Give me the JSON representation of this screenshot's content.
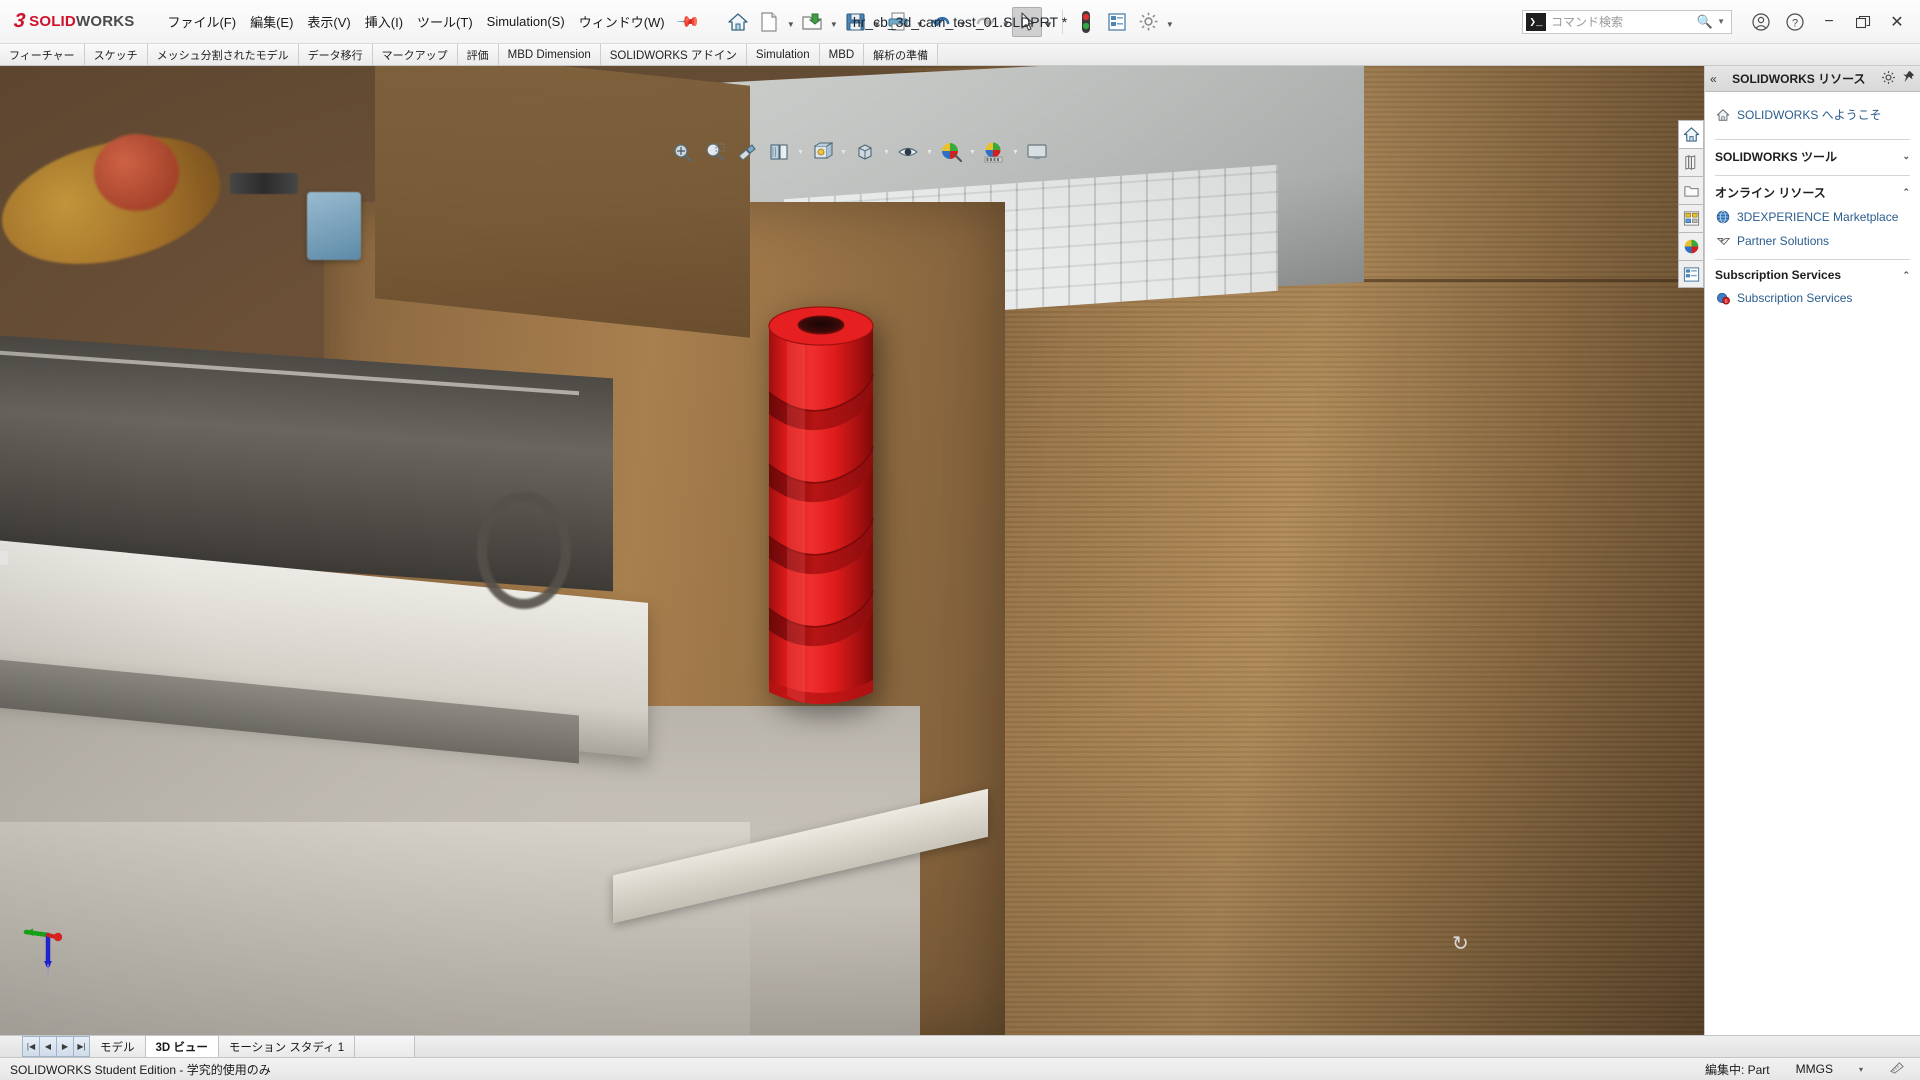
{
  "app": {
    "brand_ds": "3DS",
    "brand_solid": "SOLID",
    "brand_works": "WORKS",
    "accent_red": "#d0112b",
    "model_red": "#dd1a1a"
  },
  "titlebar": {
    "document_title": "hr_cb_3d_cam_test_01.SLDPRT *",
    "menus": [
      {
        "label": "ファイル(F)",
        "name": "menu-file"
      },
      {
        "label": "編集(E)",
        "name": "menu-edit"
      },
      {
        "label": "表示(V)",
        "name": "menu-view"
      },
      {
        "label": "挿入(I)",
        "name": "menu-insert"
      },
      {
        "label": "ツール(T)",
        "name": "menu-tools"
      },
      {
        "label": "Simulation(S)",
        "name": "menu-simulation"
      },
      {
        "label": "ウィンドウ(W)",
        "name": "menu-window"
      }
    ],
    "tools": [
      {
        "name": "home-icon",
        "title": "ホーム"
      },
      {
        "name": "new-document-icon",
        "title": "新規"
      },
      {
        "name": "open-folder-icon",
        "title": "開く"
      },
      {
        "name": "save-icon",
        "title": "保存"
      },
      {
        "name": "print-icon",
        "title": "印刷"
      },
      {
        "name": "undo-icon",
        "title": "元に戻す"
      },
      {
        "name": "redo-icon",
        "title": "やり直し"
      },
      {
        "name": "select-cursor-icon",
        "title": "選択"
      },
      {
        "name": "traffic-light-icon",
        "title": "再構築"
      },
      {
        "name": "options-list-icon",
        "title": "オプション"
      },
      {
        "name": "gear-settings-icon",
        "title": "設定"
      }
    ],
    "search": {
      "placeholder": "コマンド検索",
      "prompt_glyph": "❯_"
    },
    "window": {
      "account": "account-icon",
      "help": "help-icon",
      "minimize": "−",
      "restore": "❐",
      "close": "✕"
    }
  },
  "command_tabs": [
    {
      "label": "フィーチャー",
      "selected": false
    },
    {
      "label": "スケッチ",
      "selected": false
    },
    {
      "label": "メッシュ分割されたモデル",
      "selected": false
    },
    {
      "label": "データ移行",
      "selected": false
    },
    {
      "label": "マークアップ",
      "selected": false
    },
    {
      "label": "評価",
      "selected": false
    },
    {
      "label": "MBD Dimension",
      "selected": false
    },
    {
      "label": "SOLIDWORKS アドイン",
      "selected": false
    },
    {
      "label": "Simulation",
      "selected": false
    },
    {
      "label": "MBD",
      "selected": false
    },
    {
      "label": "解析の準備",
      "selected": false
    }
  ],
  "view_toolbar": [
    {
      "name": "zoom-to-fit-icon",
      "has_caret": false
    },
    {
      "name": "zoom-to-area-icon",
      "has_caret": false
    },
    {
      "name": "previous-view-icon",
      "has_caret": false
    },
    {
      "name": "section-view-icon",
      "has_caret": false
    },
    {
      "name": "view-orientation-icon",
      "has_caret": true
    },
    {
      "name": "display-style-icon",
      "has_caret": true
    },
    {
      "name": "hide-show-items-icon",
      "has_caret": true
    },
    {
      "name": "edit-appearance-icon",
      "has_caret": true
    },
    {
      "name": "apply-scene-icon",
      "has_caret": true
    },
    {
      "name": "view-settings-icon",
      "has_caret": false
    }
  ],
  "task_pane": {
    "header_title": "SOLIDWORKS リソース",
    "collapse_glyph": "«",
    "gear": "gear-icon",
    "pin": "pin-icon",
    "welcome": {
      "label": "SOLIDWORKS へようこそ",
      "icon": "home-icon"
    },
    "sections": [
      {
        "title": "SOLIDWORKS ツール",
        "expanded": false,
        "arrow": "⌄",
        "links": []
      },
      {
        "title": "オンライン リソース",
        "expanded": true,
        "arrow": "⌃",
        "links": [
          {
            "label": "3DEXPERIENCE Marketplace",
            "icon": "globe-icon"
          },
          {
            "label": "Partner Solutions",
            "icon": "partner-icon"
          }
        ]
      },
      {
        "title": "Subscription Services",
        "expanded": true,
        "arrow": "⌃",
        "links": [
          {
            "label": "Subscription Services",
            "icon": "subscription-icon"
          }
        ]
      }
    ],
    "rail": [
      {
        "name": "rail-home-icon",
        "active": true
      },
      {
        "name": "rail-design-library-icon",
        "active": false
      },
      {
        "name": "rail-file-explorer-icon",
        "active": false
      },
      {
        "name": "rail-view-palette-icon",
        "active": false
      },
      {
        "name": "rail-appearances-scenes-icon",
        "active": false
      },
      {
        "name": "rail-custom-properties-icon",
        "active": false
      }
    ]
  },
  "document_tabs": {
    "nav": [
      "|◀",
      "◀",
      "▶",
      "▶|"
    ],
    "tabs": [
      {
        "label": "モデル",
        "selected": false
      },
      {
        "label": "3D ビュー",
        "selected": true
      },
      {
        "label": "モーション スタディ 1",
        "selected": false
      }
    ]
  },
  "statusbar": {
    "left": "SOLIDWORKS Student Edition - 学究的使用のみ",
    "editing": "編集中: Part",
    "units": "MMGS",
    "units_caret": "▾",
    "overlay_icon": "units-settings-icon"
  },
  "viewport": {
    "model_name": "red-helical-cam-part",
    "triad": {
      "x_axis_color": "#cc2020",
      "y_axis_color": "#16a016",
      "z_axis_color": "#2222cc"
    },
    "rotate_cursor": "↻"
  }
}
